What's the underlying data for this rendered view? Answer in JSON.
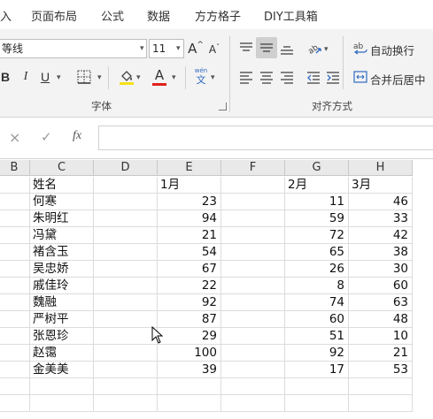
{
  "tabs": [
    "入",
    "页面布局",
    "公式",
    "数据",
    "方方格子",
    "DIY工具箱"
  ],
  "font": {
    "name": "等线",
    "size": "11",
    "grow_label": "A",
    "shrink_label": "A",
    "bold": "B",
    "italic": "I",
    "underline": "U",
    "fill_letter": "A",
    "color_letter": "A",
    "phonetic_top": "wén",
    "phonetic_bottom": "文",
    "group_label": "字体",
    "fill_color": "#f5e21a",
    "font_color": "#e0201c"
  },
  "alignment": {
    "wrap_label": "自动换行",
    "merge_label": "合并后居中",
    "group_label": "对齐方式"
  },
  "formula_bar": {
    "cancel": "×",
    "confirm": "✓",
    "fx": "fx",
    "value": ""
  },
  "columns": [
    "B",
    "C",
    "D",
    "E",
    "F",
    "G",
    "H"
  ],
  "header_row": {
    "C": "姓名",
    "E": "1月",
    "G": "2月",
    "H": "3月"
  },
  "rows": [
    {
      "name": "何寒",
      "m1": "23",
      "m2": "11",
      "m3": "46"
    },
    {
      "name": "朱明红",
      "m1": "94",
      "m2": "59",
      "m3": "33"
    },
    {
      "name": "冯黛",
      "m1": "21",
      "m2": "72",
      "m3": "42"
    },
    {
      "name": "褚含玉",
      "m1": "54",
      "m2": "65",
      "m3": "38"
    },
    {
      "name": "吴忠娇",
      "m1": "67",
      "m2": "26",
      "m3": "30"
    },
    {
      "name": "戚佳玲",
      "m1": "22",
      "m2": "8",
      "m3": "60"
    },
    {
      "name": "魏融",
      "m1": "92",
      "m2": "74",
      "m3": "63"
    },
    {
      "name": "严树平",
      "m1": "87",
      "m2": "60",
      "m3": "48"
    },
    {
      "name": "张恩珍",
      "m1": "29",
      "m2": "51",
      "m3": "10"
    },
    {
      "name": "赵霭",
      "m1": "100",
      "m2": "92",
      "m3": "21"
    },
    {
      "name": "金美美",
      "m1": "39",
      "m2": "17",
      "m3": "53"
    }
  ]
}
